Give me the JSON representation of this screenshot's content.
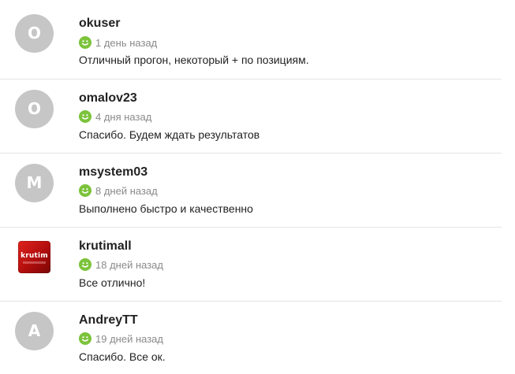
{
  "reviews": [
    {
      "avatar_letter": "O",
      "username": "okuser",
      "time_ago": "1 день назад",
      "text": "Отличный прогон, некоторый + по позициям.",
      "rating_icon": "smile-positive-icon"
    },
    {
      "avatar_letter": "O",
      "username": "omalov23",
      "time_ago": "4 дня назад",
      "text": "Спасибо. Будем ждать результатов",
      "rating_icon": "smile-positive-icon"
    },
    {
      "avatar_letter": "M",
      "username": "msystem03",
      "time_ago": "8 дней назад",
      "text": "Выполнено быстро и качественно",
      "rating_icon": "smile-positive-icon"
    },
    {
      "avatar_logo": "krutim",
      "username": "krutimall",
      "time_ago": "18 дней назад",
      "text": "Все отлично!",
      "rating_icon": "smile-positive-icon"
    },
    {
      "avatar_letter": "A",
      "username": "AndreyTT",
      "time_ago": "19 дней назад",
      "text": "Спасибо. Все ок.",
      "rating_icon": "smile-positive-icon"
    }
  ],
  "colors": {
    "avatar_bg": "#c6c6c6",
    "positive": "#7cc33b",
    "divider": "#e4e4e4",
    "meta_text": "#8a8a8a"
  }
}
